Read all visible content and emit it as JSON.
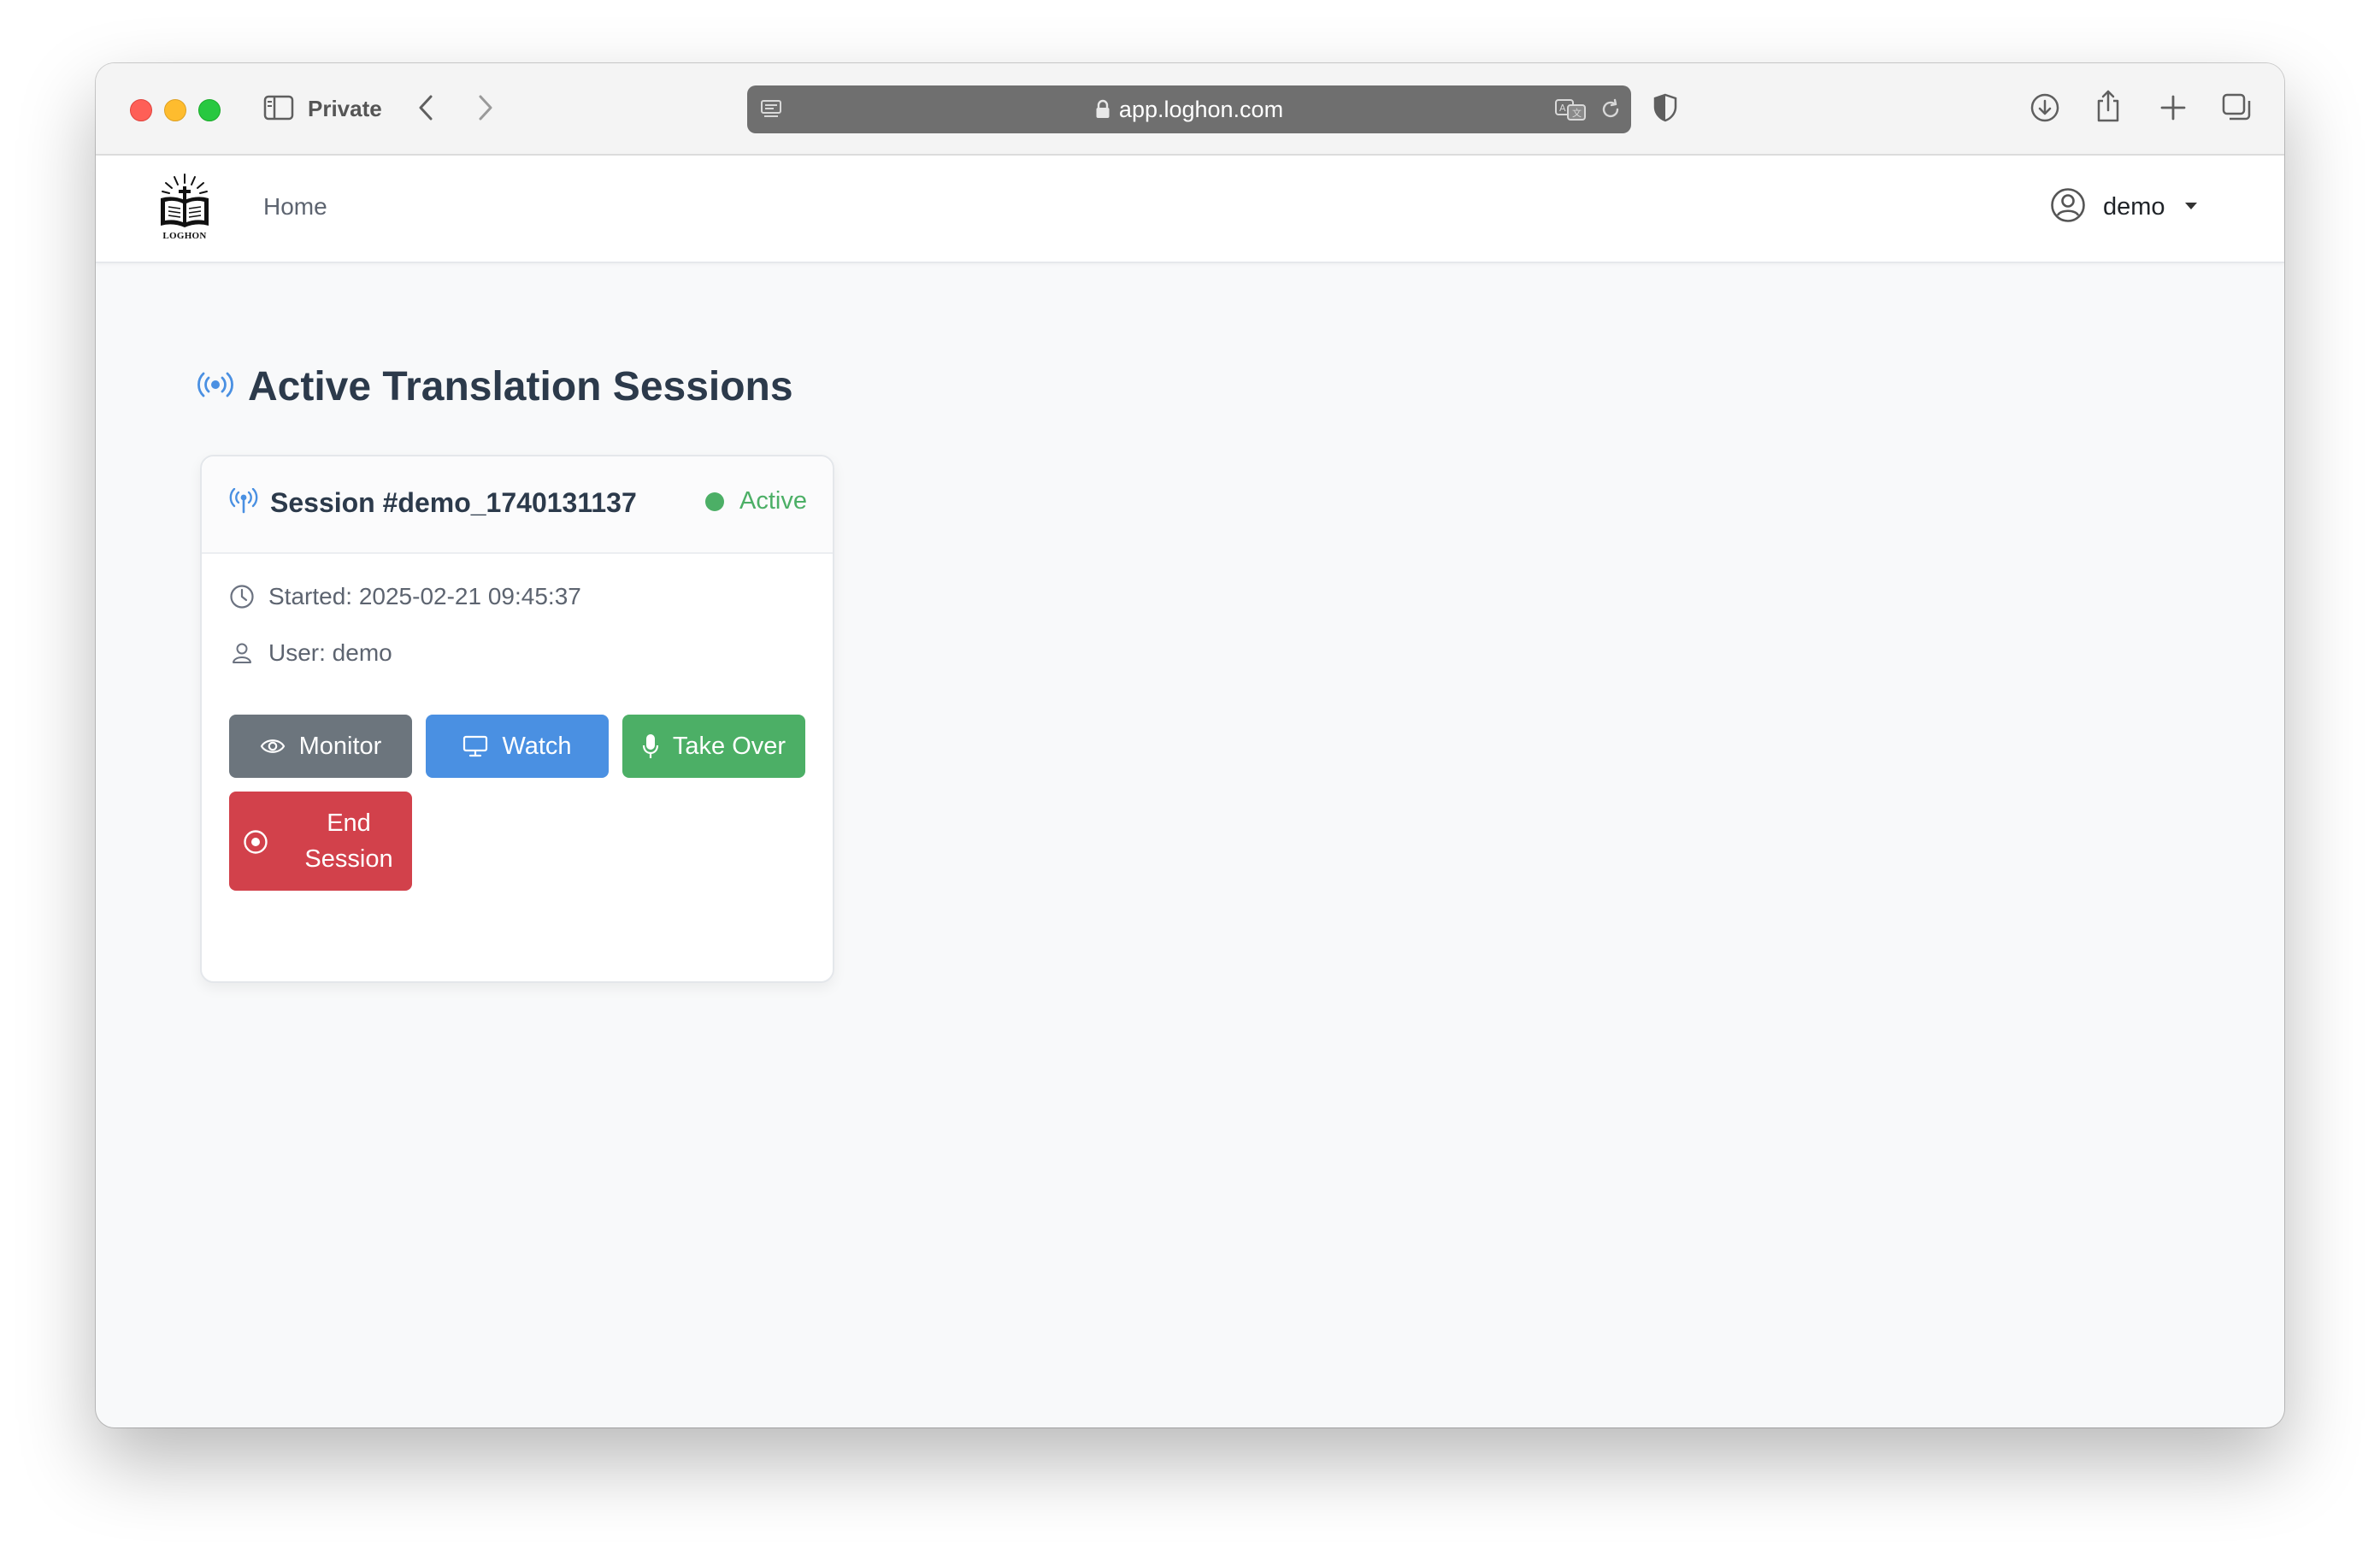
{
  "browser": {
    "private_label": "Private",
    "url": "app.loghon.com"
  },
  "navbar": {
    "logo_text": "LOGHON",
    "home_label": "Home",
    "user_name": "demo"
  },
  "page": {
    "title": "Active Translation Sessions"
  },
  "session_card": {
    "title": "Session #demo_1740131137",
    "status": "Active",
    "started": "Started: 2025-02-21 09:45:37",
    "user": "User: demo",
    "buttons": {
      "monitor": "Monitor",
      "watch": "Watch",
      "take_over": "Take Over",
      "end_session": "End Session"
    }
  },
  "colors": {
    "monitor": "#6c757d",
    "watch": "#4a90e2",
    "take_over": "#4caf66",
    "end_session": "#d2414b",
    "status_active": "#4caf66",
    "accent_icon": "#4a90e2"
  },
  "icons": {
    "page_title": "broadcast-icon",
    "session": "antenna-icon",
    "started": "clock-icon",
    "user": "user-icon",
    "monitor": "eye-icon",
    "watch": "monitor-icon",
    "take_over": "microphone-icon",
    "end_session": "stop-circle-icon",
    "account": "user-circle-icon"
  }
}
